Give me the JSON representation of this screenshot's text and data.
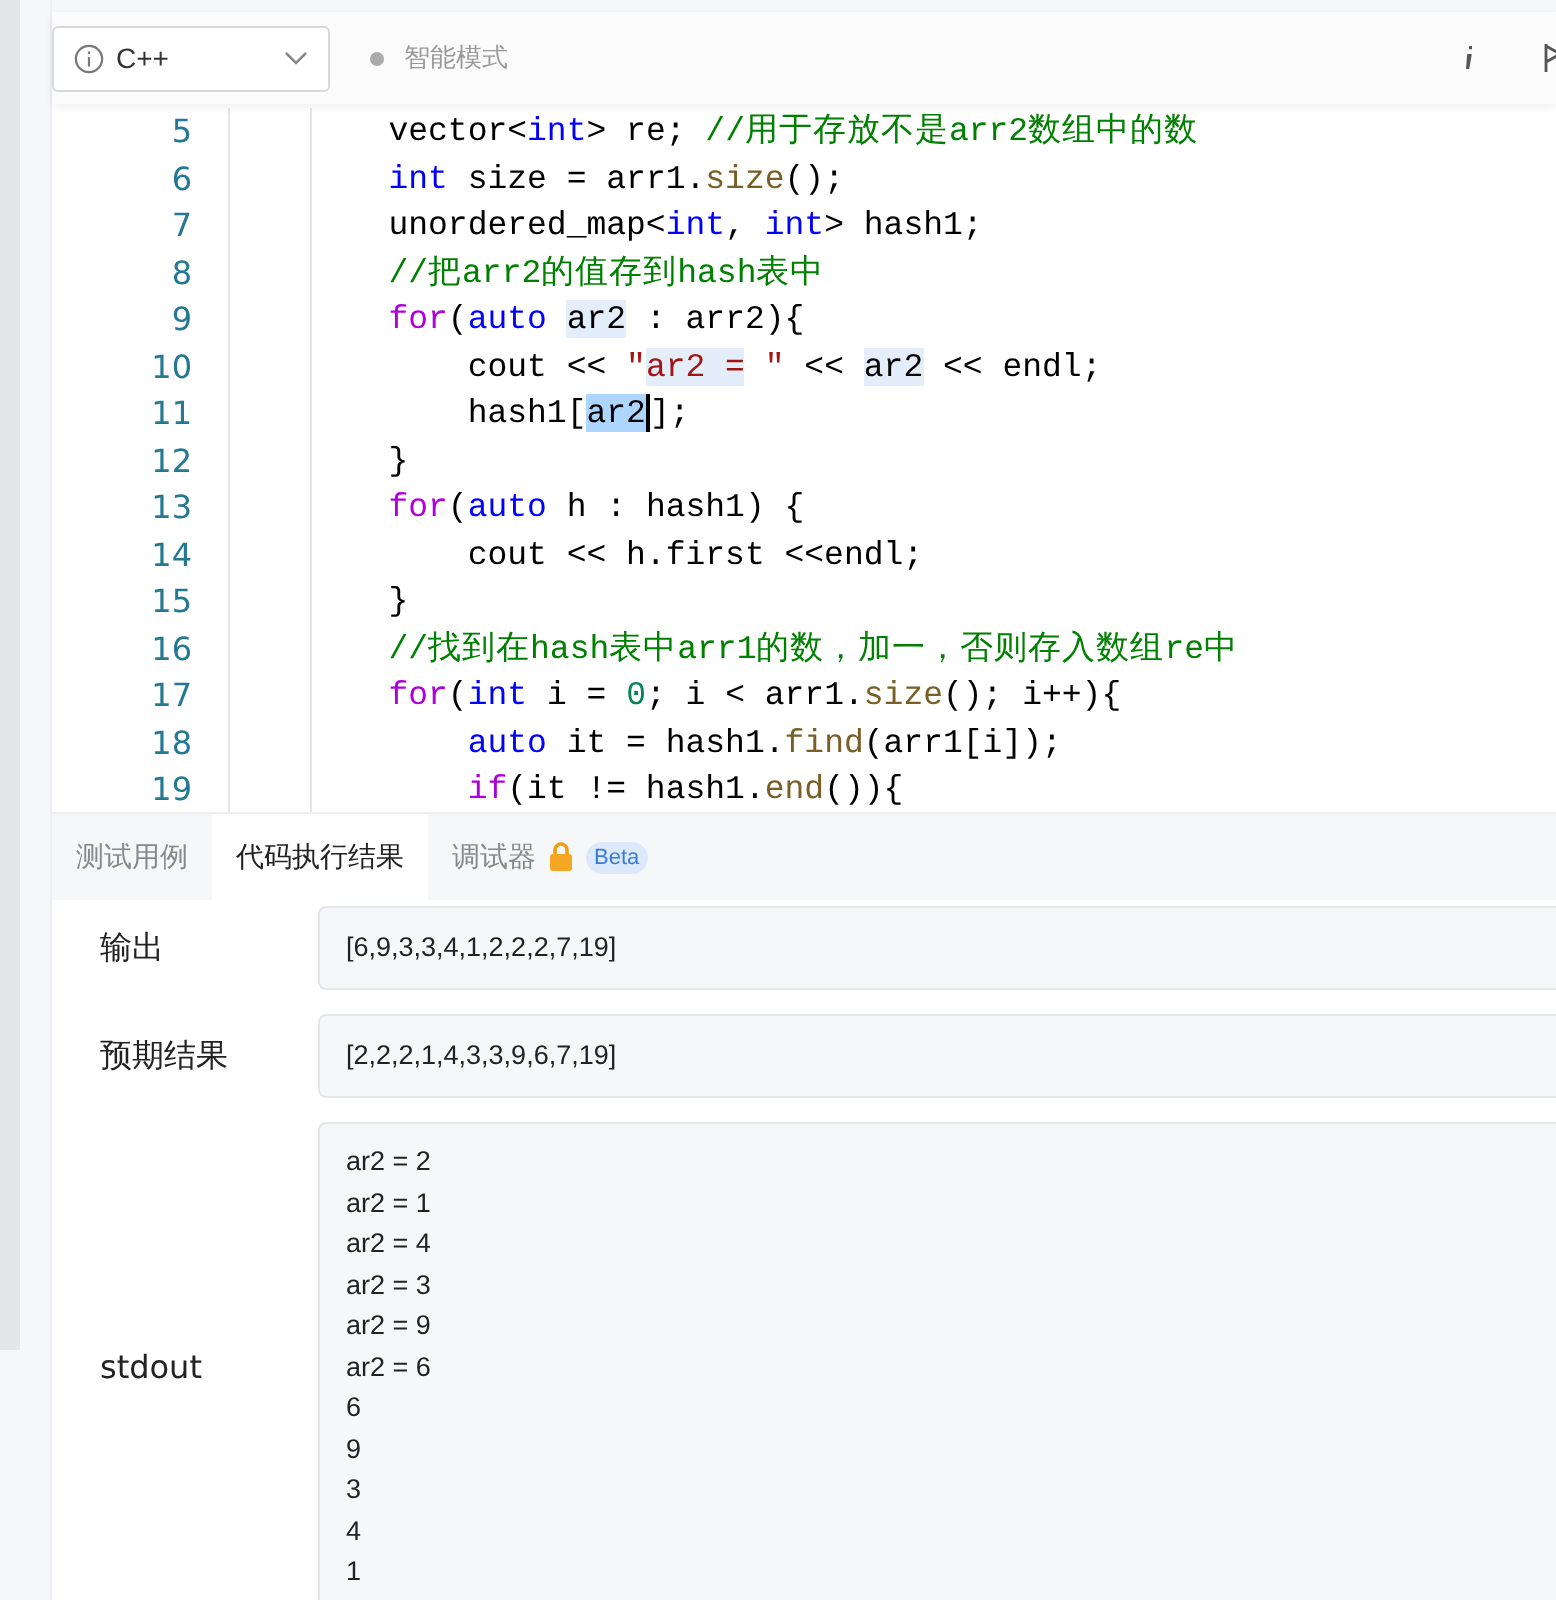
{
  "toolbar": {
    "language": "C++",
    "mode": "智能模式"
  },
  "code_lines": [
    {
      "number": "5",
      "tokens": [
        {
          "kind": "plain",
          "text": "        vector<"
        },
        {
          "kind": "type",
          "text": "int"
        },
        {
          "kind": "plain",
          "text": "> re; "
        },
        {
          "kind": "comment",
          "text": "//用于存放不是arr2数组中的数"
        }
      ]
    },
    {
      "number": "6",
      "tokens": [
        {
          "kind": "type",
          "text": "        int"
        },
        {
          "kind": "plain",
          "text": " size = arr1."
        },
        {
          "kind": "function",
          "text": "size"
        },
        {
          "kind": "plain",
          "text": "();"
        }
      ]
    },
    {
      "number": "7",
      "tokens": [
        {
          "kind": "plain",
          "text": "        unordered_map<"
        },
        {
          "kind": "type",
          "text": "int"
        },
        {
          "kind": "plain",
          "text": ", "
        },
        {
          "kind": "type",
          "text": "int"
        },
        {
          "kind": "plain",
          "text": "> hash1;"
        }
      ]
    },
    {
      "number": "8",
      "tokens": [
        {
          "kind": "comment",
          "text": "        //把arr2的值存到hash表中"
        }
      ]
    },
    {
      "number": "9",
      "tokens": [
        {
          "kind": "keyword",
          "text": "        for"
        },
        {
          "kind": "plain",
          "text": "("
        },
        {
          "kind": "type",
          "text": "auto "
        },
        {
          "kind": "match",
          "text": "ar2"
        },
        {
          "kind": "plain",
          "text": " : arr2){"
        }
      ]
    },
    {
      "number": "10",
      "tokens": [
        {
          "kind": "plain",
          "text": "            cout << "
        },
        {
          "kind": "string",
          "text": "\""
        },
        {
          "kind": "string-match",
          "text": "ar2 ="
        },
        {
          "kind": "string",
          "text": " \""
        },
        {
          "kind": "plain",
          "text": " << "
        },
        {
          "kind": "match",
          "text": "ar2"
        },
        {
          "kind": "plain",
          "text": " << endl;"
        }
      ]
    },
    {
      "number": "11",
      "tokens": [
        {
          "kind": "plain",
          "text": "            hash1["
        },
        {
          "kind": "selection",
          "text": "ar2"
        },
        {
          "kind": "plain",
          "text": "];"
        }
      ]
    },
    {
      "number": "12",
      "tokens": [
        {
          "kind": "plain",
          "text": "        }"
        }
      ]
    },
    {
      "number": "13",
      "tokens": [
        {
          "kind": "keyword",
          "text": "        for"
        },
        {
          "kind": "plain",
          "text": "("
        },
        {
          "kind": "type",
          "text": "auto"
        },
        {
          "kind": "plain",
          "text": " h : hash1) {"
        }
      ]
    },
    {
      "number": "14",
      "tokens": [
        {
          "kind": "plain",
          "text": "            cout << h.first <<endl;"
        }
      ]
    },
    {
      "number": "15",
      "tokens": [
        {
          "kind": "plain",
          "text": "        }"
        }
      ]
    },
    {
      "number": "16",
      "tokens": [
        {
          "kind": "comment",
          "text": "        //找到在hash表中arr1的数，加一，否则存入数组re中"
        }
      ]
    },
    {
      "number": "17",
      "tokens": [
        {
          "kind": "keyword",
          "text": "        for"
        },
        {
          "kind": "plain",
          "text": "("
        },
        {
          "kind": "type",
          "text": "int"
        },
        {
          "kind": "plain",
          "text": " i = "
        },
        {
          "kind": "number",
          "text": "0"
        },
        {
          "kind": "plain",
          "text": "; i < arr1."
        },
        {
          "kind": "function",
          "text": "size"
        },
        {
          "kind": "plain",
          "text": "(); i++){"
        }
      ]
    },
    {
      "number": "18",
      "tokens": [
        {
          "kind": "type",
          "text": "            auto"
        },
        {
          "kind": "plain",
          "text": " it = hash1."
        },
        {
          "kind": "function",
          "text": "find"
        },
        {
          "kind": "plain",
          "text": "(arr1[i]);"
        }
      ]
    },
    {
      "number": "19",
      "tokens": [
        {
          "kind": "keyword",
          "text": "            if"
        },
        {
          "kind": "plain",
          "text": "(it != hash1."
        },
        {
          "kind": "function",
          "text": "end"
        },
        {
          "kind": "plain",
          "text": "()){"
        }
      ]
    }
  ],
  "bottom_tabs": [
    {
      "label": "测试用例",
      "selected": false,
      "locked": false
    },
    {
      "label": "代码执行结果",
      "selected": true,
      "locked": false
    },
    {
      "label": "调试器",
      "selected": false,
      "locked": true,
      "badge": "Beta"
    }
  ],
  "results": [
    {
      "label": "输出",
      "lines": [
        "[6,9,3,3,4,1,2,2,2,7,19]"
      ]
    },
    {
      "label": "预期结果",
      "lines": [
        "[2,2,2,1,4,3,3,9,6,7,19]"
      ]
    },
    {
      "label": "stdout",
      "lines": [
        "ar2 = 2",
        "ar2 = 1",
        "ar2 = 4",
        "ar2 = 3",
        "ar2 = 9",
        "ar2 = 6",
        "6",
        "9",
        "3",
        "4",
        "1"
      ]
    }
  ]
}
